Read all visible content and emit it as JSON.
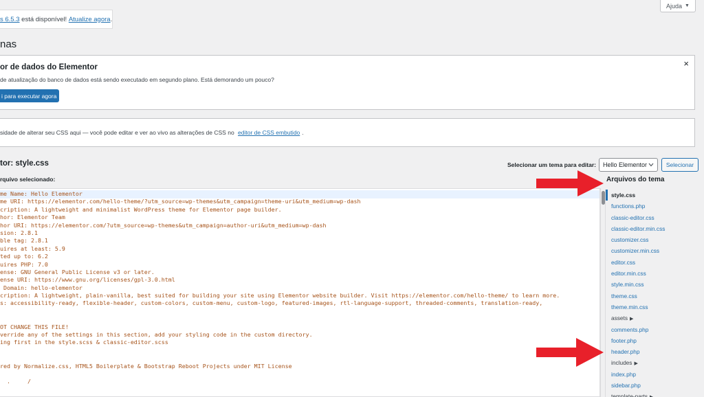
{
  "help": {
    "label": "Ajuda",
    "caret": "▼"
  },
  "update_notice": {
    "prefix_link": "s 6.5.3",
    "middle": " está disponível! ",
    "link": "Atualize agora",
    "suffix": "."
  },
  "page_title": "nas",
  "elementor_notice": {
    "title": "or de dados do Elementor",
    "message": "de atualização do banco de dados está sendo executado em segundo plano. Está demorando um pouco?",
    "button": "i para executar agora",
    "close": "×"
  },
  "css_notice": {
    "text": "sidade de alterar seu CSS aqui — você pode editar e ver ao vivo as alterações de CSS no ",
    "link": "editor de CSS embutido",
    "suffix": "."
  },
  "editor": {
    "title": "tor: style.css",
    "selected_file_label": "rquivo selecionado:",
    "select_theme_label": "Selecionar um tema para editar:",
    "selected_theme": "Hello Elementor",
    "select_button": "Selecionar"
  },
  "code_lines": [
    "me Name: Hello Elementor",
    "me URI: https://elementor.com/hello-theme/?utm_source=wp-themes&utm_campaign=theme-uri&utm_medium=wp-dash",
    "cription: A lightweight and minimalist WordPress theme for Elementor page builder.",
    "hor: Elementor Team",
    "hor URI: https://elementor.com/?utm_source=wp-themes&utm_campaign=author-uri&utm_medium=wp-dash",
    "sion: 2.8.1",
    "ble tag: 2.8.1",
    "uires at least: 5.9",
    "ted up to: 6.2",
    "uires PHP: 7.0",
    "ense: GNU General Public License v3 or later.",
    "ense URI: https://www.gnu.org/licenses/gpl-3.0.html",
    " Domain: hello-elementor",
    "cription: A lightweight, plain-vanilla, best suited for building your site using Elementor website builder. Visit https://elementor.com/hello-theme/ to learn more.",
    "s: accessibility-ready, flexible-header, custom-colors, custom-menu, custom-logo, featured-images, rtl-language-support, threaded-comments, translation-ready,",
    "",
    "",
    "OT CHANGE THIS FILE!",
    "verride any of the settings in this section, add your styling code in the custom directory.",
    "ing first in the style.scss & classic-editor.scss",
    "",
    "",
    "red by Normalize.css, HTML5 Boilerplate & Bootstrap Reboot Projects under MIT License",
    "",
    "  .     /"
  ],
  "files_panel": {
    "title": "Arquivos do tema",
    "files": [
      {
        "label": "style.css",
        "type": "file",
        "active": true
      },
      {
        "label": "functions.php",
        "type": "file"
      },
      {
        "label": "classic-editor.css",
        "type": "file"
      },
      {
        "label": "classic-editor.min.css",
        "type": "file"
      },
      {
        "label": "customizer.css",
        "type": "file"
      },
      {
        "label": "customizer.min.css",
        "type": "file"
      },
      {
        "label": "editor.css",
        "type": "file"
      },
      {
        "label": "editor.min.css",
        "type": "file"
      },
      {
        "label": "style.min.css",
        "type": "file"
      },
      {
        "label": "theme.css",
        "type": "file"
      },
      {
        "label": "theme.min.css",
        "type": "file"
      },
      {
        "label": "assets",
        "type": "folder"
      },
      {
        "label": "comments.php",
        "type": "file"
      },
      {
        "label": "footer.php",
        "type": "file"
      },
      {
        "label": "header.php",
        "type": "file"
      },
      {
        "label": "includes",
        "type": "folder"
      },
      {
        "label": "index.php",
        "type": "file"
      },
      {
        "label": "sidebar.php",
        "type": "file"
      },
      {
        "label": "template-parts",
        "type": "folder"
      }
    ]
  },
  "colors": {
    "accent": "#2271b1",
    "annotation_arrow": "#e8202a",
    "code_text": "#a6531a"
  }
}
